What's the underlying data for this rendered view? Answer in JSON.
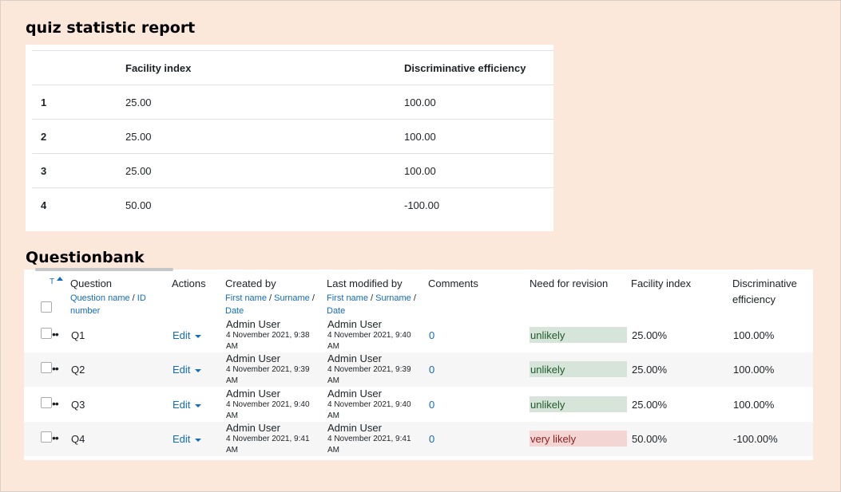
{
  "stat_report": {
    "title": "quiz statistic report",
    "headers": [
      "",
      "Facility index",
      "Discriminative efficiency"
    ],
    "rows": [
      {
        "num": "1",
        "facility": "25.00",
        "discrim": "100.00"
      },
      {
        "num": "2",
        "facility": "25.00",
        "discrim": "100.00"
      },
      {
        "num": "3",
        "facility": "25.00",
        "discrim": "100.00"
      },
      {
        "num": "4",
        "facility": "50.00",
        "discrim": "-100.00"
      }
    ]
  },
  "questionbank": {
    "title": "Questionbank",
    "sort_label": "T",
    "headers": {
      "question": "Question",
      "question_sub1": "Question name",
      "question_sub2": "ID number",
      "actions": "Actions",
      "created_by": "Created by",
      "last_modified_by": "Last modified by",
      "sub_first": "First name",
      "sub_surname": "Surname",
      "sub_date": "Date",
      "separator": "/",
      "comments": "Comments",
      "need_revision": "Need for revision",
      "facility": "Facility index",
      "discrim": "Discriminative efficiency"
    },
    "rows": [
      {
        "name": "Q1",
        "action": "Edit",
        "created_user": "Admin User",
        "created_date": "4 November 2021, 9:38 AM",
        "modified_user": "Admin User",
        "modified_date": "4 November 2021, 9:40 AM",
        "comments": "0",
        "revision": "unlikely",
        "facility": "25.00%",
        "discrim": "100.00%"
      },
      {
        "name": "Q2",
        "action": "Edit",
        "created_user": "Admin User",
        "created_date": "4 November 2021, 9:39 AM",
        "modified_user": "Admin User",
        "modified_date": "4 November 2021, 9:39 AM",
        "comments": "0",
        "revision": "unlikely",
        "facility": "25.00%",
        "discrim": "100.00%"
      },
      {
        "name": "Q3",
        "action": "Edit",
        "created_user": "Admin User",
        "created_date": "4 November 2021, 9:40 AM",
        "modified_user": "Admin User",
        "modified_date": "4 November 2021, 9:40 AM",
        "comments": "0",
        "revision": "unlikely",
        "facility": "25.00%",
        "discrim": "100.00%"
      },
      {
        "name": "Q4",
        "action": "Edit",
        "created_user": "Admin User",
        "created_date": "4 November 2021, 9:41 AM",
        "modified_user": "Admin User",
        "modified_date": "4 November 2021, 9:41 AM",
        "comments": "0",
        "revision": "very likely",
        "facility": "50.00%",
        "discrim": "-100.00%"
      }
    ]
  },
  "colors": {
    "page_bg": "#fce8da",
    "link": "#0f6cbf",
    "unlikely_bg": "#d6e4d9",
    "unlikely_text": "#1e5b2a",
    "very_likely_bg": "#f3d6d4",
    "very_likely_text": "#8a1e1e"
  }
}
